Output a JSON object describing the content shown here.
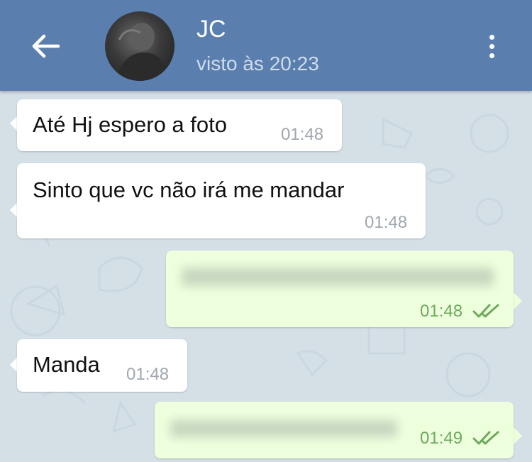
{
  "header": {
    "contact_name": "JC",
    "last_seen": "visto às 20:23",
    "bg_color": "#5a7fae"
  },
  "icons": {
    "back": "arrow-left-icon",
    "menu": "more-vertical-icon",
    "read_receipt": "double-check-icon"
  },
  "messages": [
    {
      "direction": "in",
      "text": "Até Hj espero a foto",
      "time": "01:48"
    },
    {
      "direction": "in",
      "text": "Sinto que vc não irá me mandar",
      "time": "01:48"
    },
    {
      "direction": "out",
      "text": "",
      "time": "01:48",
      "blurred": true
    },
    {
      "direction": "in",
      "text": "Manda",
      "time": "01:48"
    },
    {
      "direction": "out",
      "text": "",
      "time": "01:49",
      "blurred": true
    }
  ],
  "colors": {
    "incoming_bubble": "#ffffff",
    "outgoing_bubble": "#eeffde",
    "read_check": "#6ea95c",
    "chat_background": "#d4e0e6"
  }
}
